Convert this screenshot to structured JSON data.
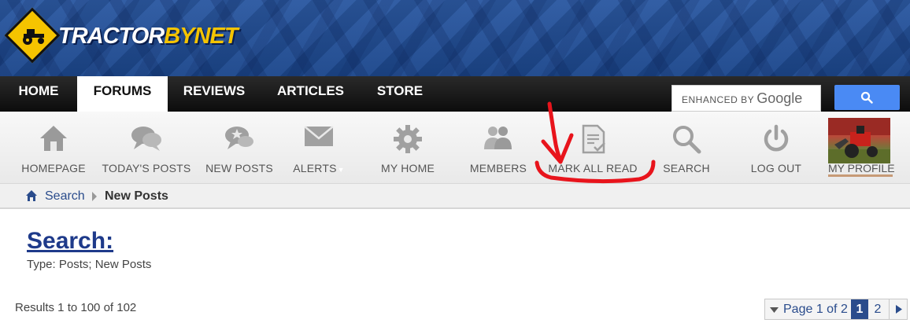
{
  "header": {
    "logo_text_a": "TRACTOR",
    "logo_text_b": "BY",
    "logo_text_c": "NET"
  },
  "nav": {
    "items": [
      "HOME",
      "FORUMS",
      "REVIEWS",
      "ARTICLES",
      "STORE"
    ],
    "active": "FORUMS"
  },
  "search": {
    "enhanced_by": "ENHANCED BY",
    "google": "Google"
  },
  "toolbar": {
    "items": [
      {
        "label": "HOMEPAGE",
        "icon": "house-icon"
      },
      {
        "label": "TODAY'S POSTS",
        "icon": "chat-bubbles-icon"
      },
      {
        "label": "NEW POSTS",
        "icon": "star-bubble-icon"
      },
      {
        "label": "ALERTS",
        "icon": "envelope-icon"
      },
      {
        "label": "MY HOME",
        "icon": "gear-icon"
      },
      {
        "label": "MEMBERS",
        "icon": "users-icon"
      },
      {
        "label": "MARK ALL READ",
        "icon": "document-check-icon"
      },
      {
        "label": "SEARCH",
        "icon": "magnifier-icon"
      },
      {
        "label": "LOG OUT",
        "icon": "power-icon"
      }
    ],
    "profile_label": "MY PROFILE"
  },
  "breadcrumb": {
    "link": "Search",
    "current": "New Posts"
  },
  "page": {
    "title": "Search:",
    "subtitle": "Type: Posts; New Posts",
    "results": "Results 1 to 100 of 102"
  },
  "pager": {
    "label": "Page 1 of 2",
    "current": "1",
    "next_page": "2"
  },
  "colors": {
    "nav_bg": "#0c0c0c",
    "link": "#2a4c8c",
    "search_button": "#4a8af4",
    "annotation": "#e8141c"
  }
}
